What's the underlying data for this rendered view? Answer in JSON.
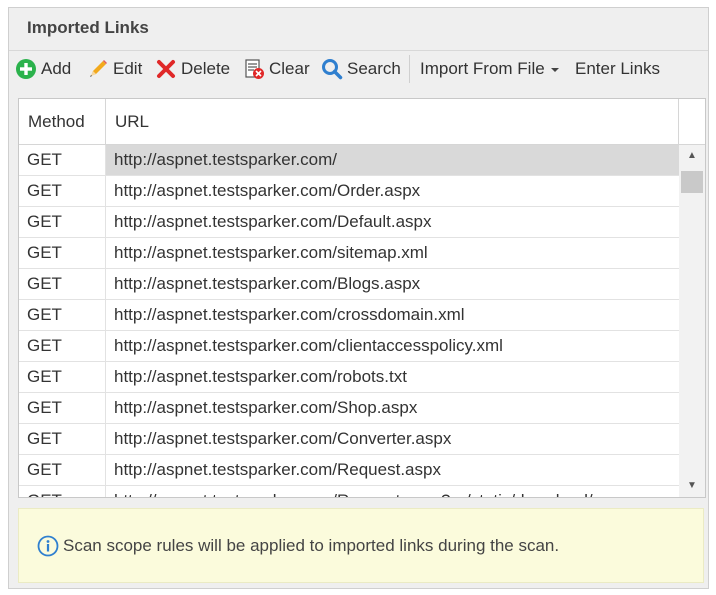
{
  "panel": {
    "title": "Imported Links"
  },
  "toolbar": {
    "add": "Add",
    "edit": "Edit",
    "delete": "Delete",
    "clear": "Clear",
    "search": "Search",
    "import_from_file": "Import From File",
    "enter_links": "Enter Links"
  },
  "grid": {
    "columns": [
      "Method",
      "URL"
    ],
    "rows": [
      {
        "method": "GET",
        "url": "http://aspnet.testsparker.com/",
        "selected": true
      },
      {
        "method": "GET",
        "url": "http://aspnet.testsparker.com/Order.aspx"
      },
      {
        "method": "GET",
        "url": "http://aspnet.testsparker.com/Default.aspx"
      },
      {
        "method": "GET",
        "url": "http://aspnet.testsparker.com/sitemap.xml"
      },
      {
        "method": "GET",
        "url": "http://aspnet.testsparker.com/Blogs.aspx"
      },
      {
        "method": "GET",
        "url": "http://aspnet.testsparker.com/crossdomain.xml"
      },
      {
        "method": "GET",
        "url": "http://aspnet.testsparker.com/clientaccesspolicy.xml"
      },
      {
        "method": "GET",
        "url": "http://aspnet.testsparker.com/robots.txt"
      },
      {
        "method": "GET",
        "url": "http://aspnet.testsparker.com/Shop.aspx"
      },
      {
        "method": "GET",
        "url": "http://aspnet.testsparker.com/Converter.aspx"
      },
      {
        "method": "GET",
        "url": "http://aspnet.testsparker.com/Request.aspx"
      },
      {
        "method": "GET",
        "url": "http://aspnet.testsparker.com/Request.aspx?r=/static/download/"
      }
    ]
  },
  "info": {
    "message": "Scan scope rules will be applied to imported links during the scan."
  },
  "colors": {
    "add_green": "#2bb24c",
    "delete_red": "#e02828",
    "search_blue": "#2f7fcf",
    "info_blue": "#2f7fcf",
    "selected_row": "#d9d9d9"
  }
}
